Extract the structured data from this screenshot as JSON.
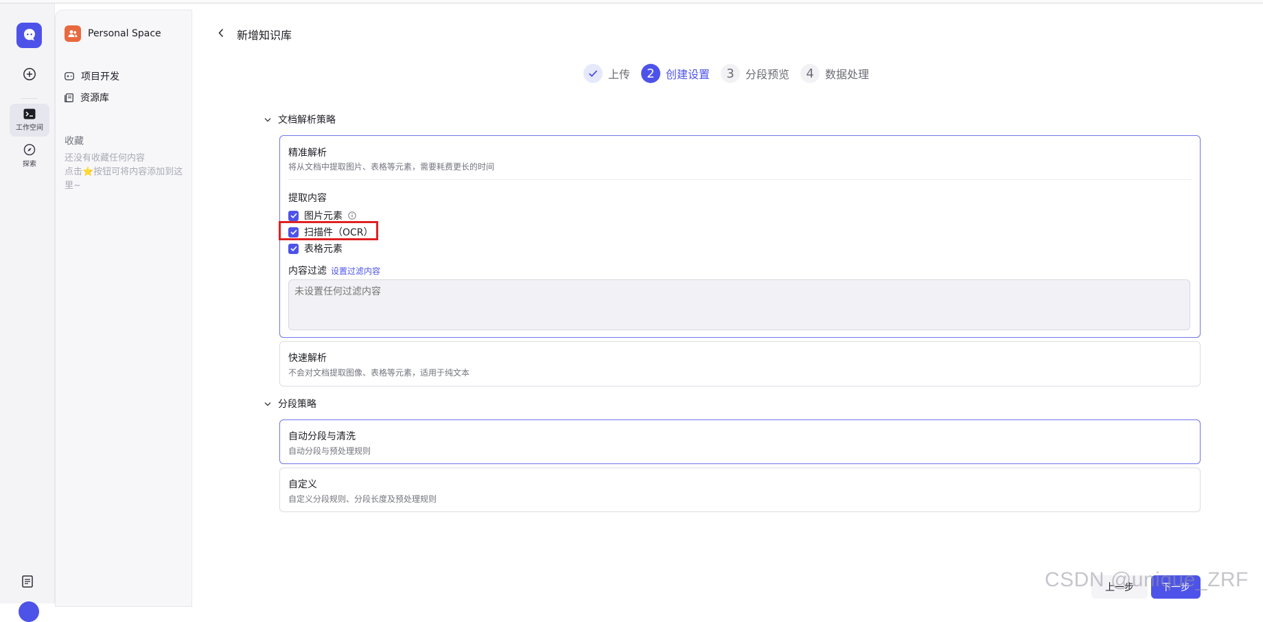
{
  "rail": {
    "workspace_label": "工作空间",
    "explore_label": "探索"
  },
  "sidebar": {
    "space_name": "Personal Space",
    "items": [
      {
        "label": "项目开发",
        "icon": "gamepad-icon"
      },
      {
        "label": "资源库",
        "icon": "library-icon"
      }
    ],
    "favorites_title": "收藏",
    "favorites_empty_line1": "还没有收藏任何内容",
    "favorites_empty_line2": "点击⭐按钮可将内容添加到这里~"
  },
  "header": {
    "title": "新增知识库"
  },
  "steps": [
    {
      "number": "",
      "label": "上传",
      "state": "done"
    },
    {
      "number": "2",
      "label": "创建设置",
      "state": "active"
    },
    {
      "number": "3",
      "label": "分段预览",
      "state": "todo"
    },
    {
      "number": "4",
      "label": "数据处理",
      "state": "todo"
    }
  ],
  "parse_strategy": {
    "title": "文档解析策略",
    "precise": {
      "title": "精准解析",
      "desc": "将从文档中提取图片、表格等元素，需要耗费更长的时间",
      "extract_title": "提取内容",
      "options": [
        {
          "label": "图片元素",
          "checked": true
        },
        {
          "label": "扫描件（OCR）",
          "checked": true
        },
        {
          "label": "表格元素",
          "checked": true
        }
      ],
      "filter_label": "内容过滤",
      "filter_link": "设置过滤内容",
      "filter_placeholder": "未设置任何过滤内容"
    },
    "fast": {
      "title": "快速解析",
      "desc": "不会对文档提取图像、表格等元素，适用于纯文本"
    }
  },
  "segment_strategy": {
    "title": "分段策略",
    "auto": {
      "title": "自动分段与清洗",
      "desc": "自动分段与预处理规则"
    },
    "custom": {
      "title": "自定义",
      "desc": "自定义分段规则、分段长度及预处理规则"
    }
  },
  "footer": {
    "prev_label": "上一步",
    "next_label": "下一步"
  },
  "watermark": "CSDN @unique_ZRF",
  "colors": {
    "accent": "#4d53e8",
    "highlight_box": "#e02020",
    "space_icon": "#e8693f"
  }
}
